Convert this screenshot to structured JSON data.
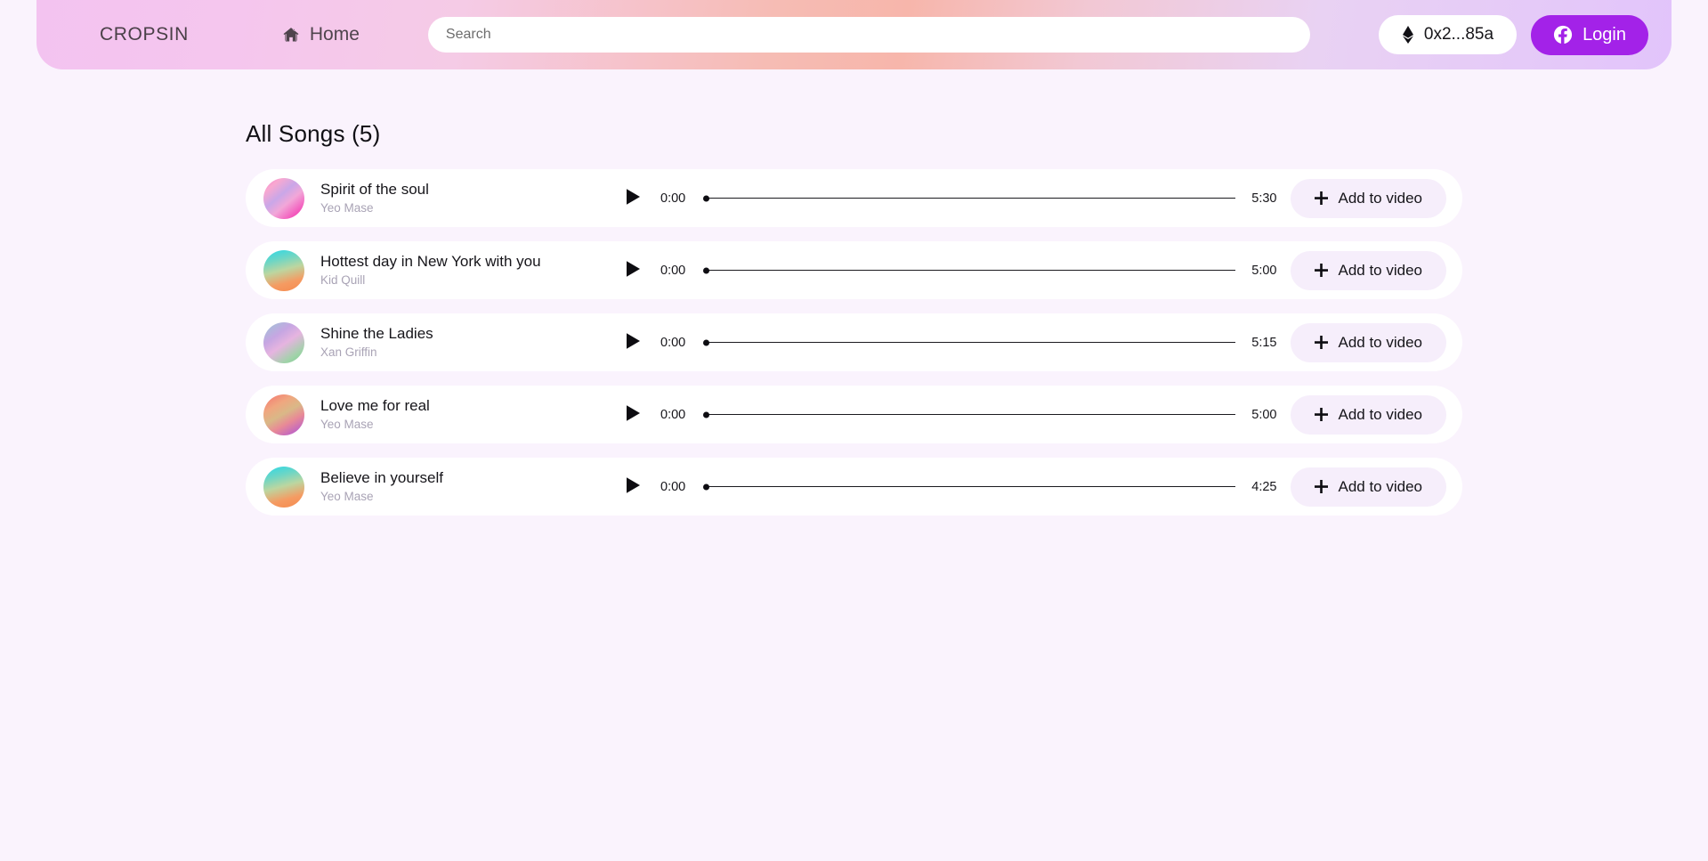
{
  "header": {
    "brand": "CROPSIN",
    "nav_home_label": "Home",
    "home_icon": "home-icon",
    "search_placeholder": "Search",
    "search_value": "",
    "wallet_address": "0x2...85a",
    "wallet_icon": "ethereum-icon",
    "login_label": "Login",
    "login_icon": "facebook-icon",
    "accent_color": "#a322e8",
    "gradient_from": "#f3c3f0",
    "gradient_mid": "#f7b6ab",
    "gradient_to": "#e2c4fb"
  },
  "main": {
    "page_title": "All Songs (5)",
    "page_background": "#faf3fd",
    "row_background": "#ffffff",
    "add_button_background": "#f6eefb",
    "songs": [
      {
        "title": "Spirit of the soul",
        "artist": "Yeo Mase",
        "current_time": "0:00",
        "duration": "5:30",
        "progress_percent": 0,
        "play_icon": "play-icon",
        "add_label": "Add to video",
        "add_icon": "plus-icon",
        "art_gradient": "linear-gradient(140deg, #f07fd0 0%, #f9a8d0 20%, #c9a7e8 42%, #f2a7d8 60%, #f41fa8 100%)"
      },
      {
        "title": "Hottest day in New York with you",
        "artist": "Kid Quill",
        "current_time": "0:00",
        "duration": "5:00",
        "progress_percent": 0,
        "play_icon": "play-icon",
        "add_label": "Add to video",
        "add_icon": "plus-icon",
        "art_gradient": "linear-gradient(165deg, #2ad8e8 0%, #6fd6c4 26%, #bcd6a0 48%, #f59b62 75%, #f58a4e 100%)"
      },
      {
        "title": "Shine the Ladies",
        "artist": "Xan Griffin",
        "current_time": "0:00",
        "duration": "5:15",
        "progress_percent": 0,
        "play_icon": "play-icon",
        "add_label": "Add to video",
        "add_icon": "plus-icon",
        "art_gradient": "linear-gradient(145deg, #9bc7d6 0%, #c6a6e2 32%, #e6b4e0 52%, #9fd3a8 80%, #7cc98e 100%)"
      },
      {
        "title": "Love me for real",
        "artist": "Yeo Mase",
        "current_time": "0:00",
        "duration": "5:00",
        "progress_percent": 0,
        "play_icon": "play-icon",
        "add_label": "Add to video",
        "add_icon": "plus-icon",
        "art_gradient": "linear-gradient(150deg, #f4716f 0%, #f0a67f 28%, #d9b887 48%, #e88a96 66%, #a84fe0 100%)"
      },
      {
        "title": "Believe in yourself",
        "artist": "Yeo Mase",
        "current_time": "0:00",
        "duration": "4:25",
        "progress_percent": 0,
        "play_icon": "play-icon",
        "add_label": "Add to video",
        "add_icon": "plus-icon",
        "art_gradient": "linear-gradient(165deg, #2ad8e8 0%, #6fd6c4 26%, #bcd6a0 48%, #f59b62 75%, #f58a4e 100%)"
      }
    ]
  }
}
